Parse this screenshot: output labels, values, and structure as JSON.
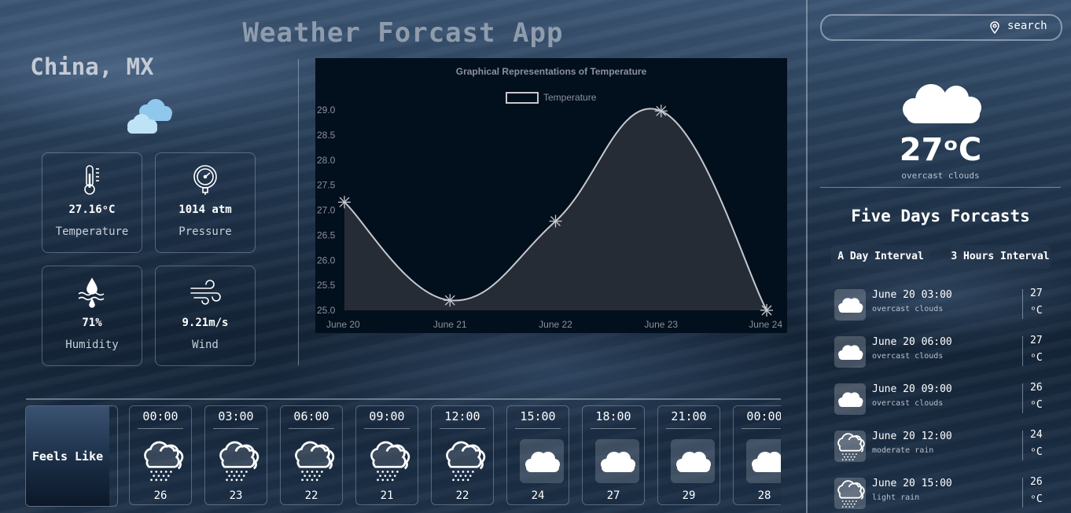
{
  "app": {
    "title": "Weather Forcast App"
  },
  "location": {
    "city": "China, MX"
  },
  "stats": [
    {
      "icon": "thermometer-icon",
      "value": "27.16ᵒC",
      "label": "Temperature"
    },
    {
      "icon": "pressure-gauge-icon",
      "value": "1014 atm",
      "label": "Pressure"
    },
    {
      "icon": "humidity-icon",
      "value": "71%",
      "label": "Humidity"
    },
    {
      "icon": "wind-icon",
      "value": "9.21m/s",
      "label": "Wind"
    }
  ],
  "chart_data": {
    "type": "line",
    "title": "Graphical Representations of Temperature",
    "categories": [
      "June 20",
      "June 21",
      "June 22",
      "June 23",
      "June 24"
    ],
    "series": [
      {
        "name": "Temperature",
        "values": [
          27.16,
          25.2,
          26.78,
          28.98,
          25.0
        ]
      }
    ],
    "ylim": [
      25.0,
      29.0
    ],
    "yticks": [
      "25.0",
      "25.5",
      "26.0",
      "26.5",
      "27.0",
      "27.5",
      "28.0",
      "28.5",
      "29.0"
    ],
    "legend": "top",
    "fill": true,
    "colors": {
      "line": "#c5c9cf",
      "fill": "#262c35",
      "text": "#8a929c"
    }
  },
  "feels_like": {
    "label": "Feels Like"
  },
  "hourly": [
    {
      "time": "00:00",
      "icon": "rain-cloud-icon",
      "temp": "26"
    },
    {
      "time": "03:00",
      "icon": "rain-cloud-icon",
      "temp": "23"
    },
    {
      "time": "06:00",
      "icon": "rain-cloud-icon",
      "temp": "22"
    },
    {
      "time": "09:00",
      "icon": "rain-cloud-icon",
      "temp": "21"
    },
    {
      "time": "12:00",
      "icon": "rain-cloud-icon",
      "temp": "22"
    },
    {
      "time": "15:00",
      "icon": "cloud-icon",
      "temp": "24"
    },
    {
      "time": "18:00",
      "icon": "cloud-icon",
      "temp": "27"
    },
    {
      "time": "21:00",
      "icon": "cloud-icon",
      "temp": "29"
    },
    {
      "time": "00:00",
      "icon": "cloud-icon",
      "temp": "28"
    }
  ],
  "search": {
    "label": "search",
    "placeholder": ""
  },
  "current": {
    "temp": "27ᵒC",
    "desc": "overcast clouds"
  },
  "forecast": {
    "title": "Five Days Forcasts",
    "tabs": [
      "A Day Interval",
      "3 Hours Interval"
    ],
    "items": [
      {
        "date": "June 20 03:00",
        "desc": "overcast clouds",
        "temp": "27",
        "unit": "ᵒC",
        "icon": "cloud-icon"
      },
      {
        "date": "June 20 06:00",
        "desc": "overcast clouds",
        "temp": "27",
        "unit": "ᵒC",
        "icon": "cloud-icon"
      },
      {
        "date": "June 20 09:00",
        "desc": "overcast clouds",
        "temp": "26",
        "unit": "ᵒC",
        "icon": "cloud-icon"
      },
      {
        "date": "June 20 12:00",
        "desc": "moderate rain",
        "temp": "24",
        "unit": "ᵒC",
        "icon": "rain-cloud-icon"
      },
      {
        "date": "June 20 15:00",
        "desc": "light rain",
        "temp": "26",
        "unit": "ᵒC",
        "icon": "rain-cloud-icon"
      }
    ]
  }
}
